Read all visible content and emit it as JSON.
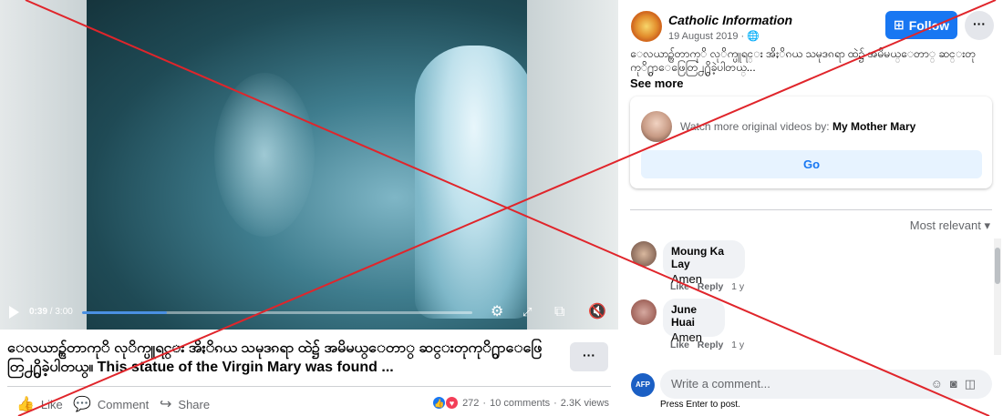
{
  "video": {
    "time_current": "0:39",
    "time_total": "3:00",
    "progress": 0.217,
    "controls": [
      "settings-icon",
      "fullscreen-icon",
      "pip-icon",
      "volume-mute-icon"
    ]
  },
  "post": {
    "caption": "ေလယာဥ္က်တာကုိ လုိက္ပူရင္း အိႏိၵယ သမုဒၵရာ ထဲ၌ အမိမယ္ေတာ္ ဆင္းတုကုိ႐ွာေဖြေတြ႕႐ွိခဲ့ပါတယ္။ This statue of the Virgin Mary was found ...",
    "more_label": "···",
    "actions": {
      "like": "Like",
      "comment": "Comment",
      "share": "Share"
    },
    "reactions_count": "272",
    "comments_count": "10 comments",
    "views": "2.3K views"
  },
  "page": {
    "name": "Catholic Information",
    "date": "19 August 2019",
    "follow_label": "Follow",
    "more_label": "···",
    "text": "ေလယာဥ္က်တာကုိ လုိက္ပူရင္း အိႏိၵယ သမုဒၵရာ ထဲ၌ အမိမယ္ေတာ္ ဆင္းတုကုိ႐ွာေဖြေတြ႕႐ွိခဲ့ပါတယ္...",
    "see_more": "See more"
  },
  "watch_more": {
    "prefix": "Watch more original videos by:",
    "channel": "My Mother Mary",
    "go_label": "Go"
  },
  "comments": {
    "sort_label": "Most relevant",
    "items": [
      {
        "name": "Moung Ka Lay",
        "text": "Amen",
        "like": "Like",
        "reply": "Reply",
        "time": "1 y"
      },
      {
        "name": "June Huai",
        "text": "Amen",
        "like": "Like",
        "reply": "Reply",
        "time": "1 y"
      }
    ],
    "write_placeholder": "Write a comment...",
    "enter_hint": "Press Enter to post.",
    "commenter_badge": "AFP"
  },
  "colors": {
    "accent": "#1877f2",
    "overlay_cross": "#e0252b"
  }
}
